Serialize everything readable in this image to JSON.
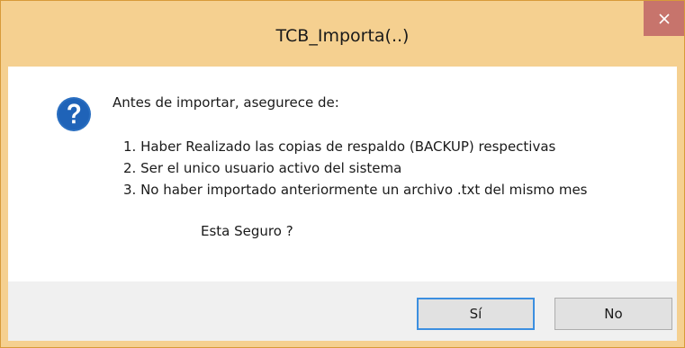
{
  "window": {
    "title": "TCB_Importa(..)"
  },
  "message": {
    "intro": "Antes de importar, asegurece de:",
    "items": [
      "1. Haber Realizado las copias de respaldo (BACKUP) respectivas",
      "2. Ser el unico usuario activo del sistema",
      "3. No haber importado anteriormente un archivo .txt del mismo mes"
    ],
    "question": "Esta Seguro ?"
  },
  "buttons": {
    "yes_label": "Sí",
    "no_label": "No"
  },
  "icons": {
    "dialog_icon": "question-icon",
    "close_icon": "close-icon"
  },
  "colors": {
    "title_bar": "#f5d090",
    "close_button": "#c7746c",
    "question_icon": "#2a6fc1",
    "default_button_border": "#3c8fe0"
  }
}
